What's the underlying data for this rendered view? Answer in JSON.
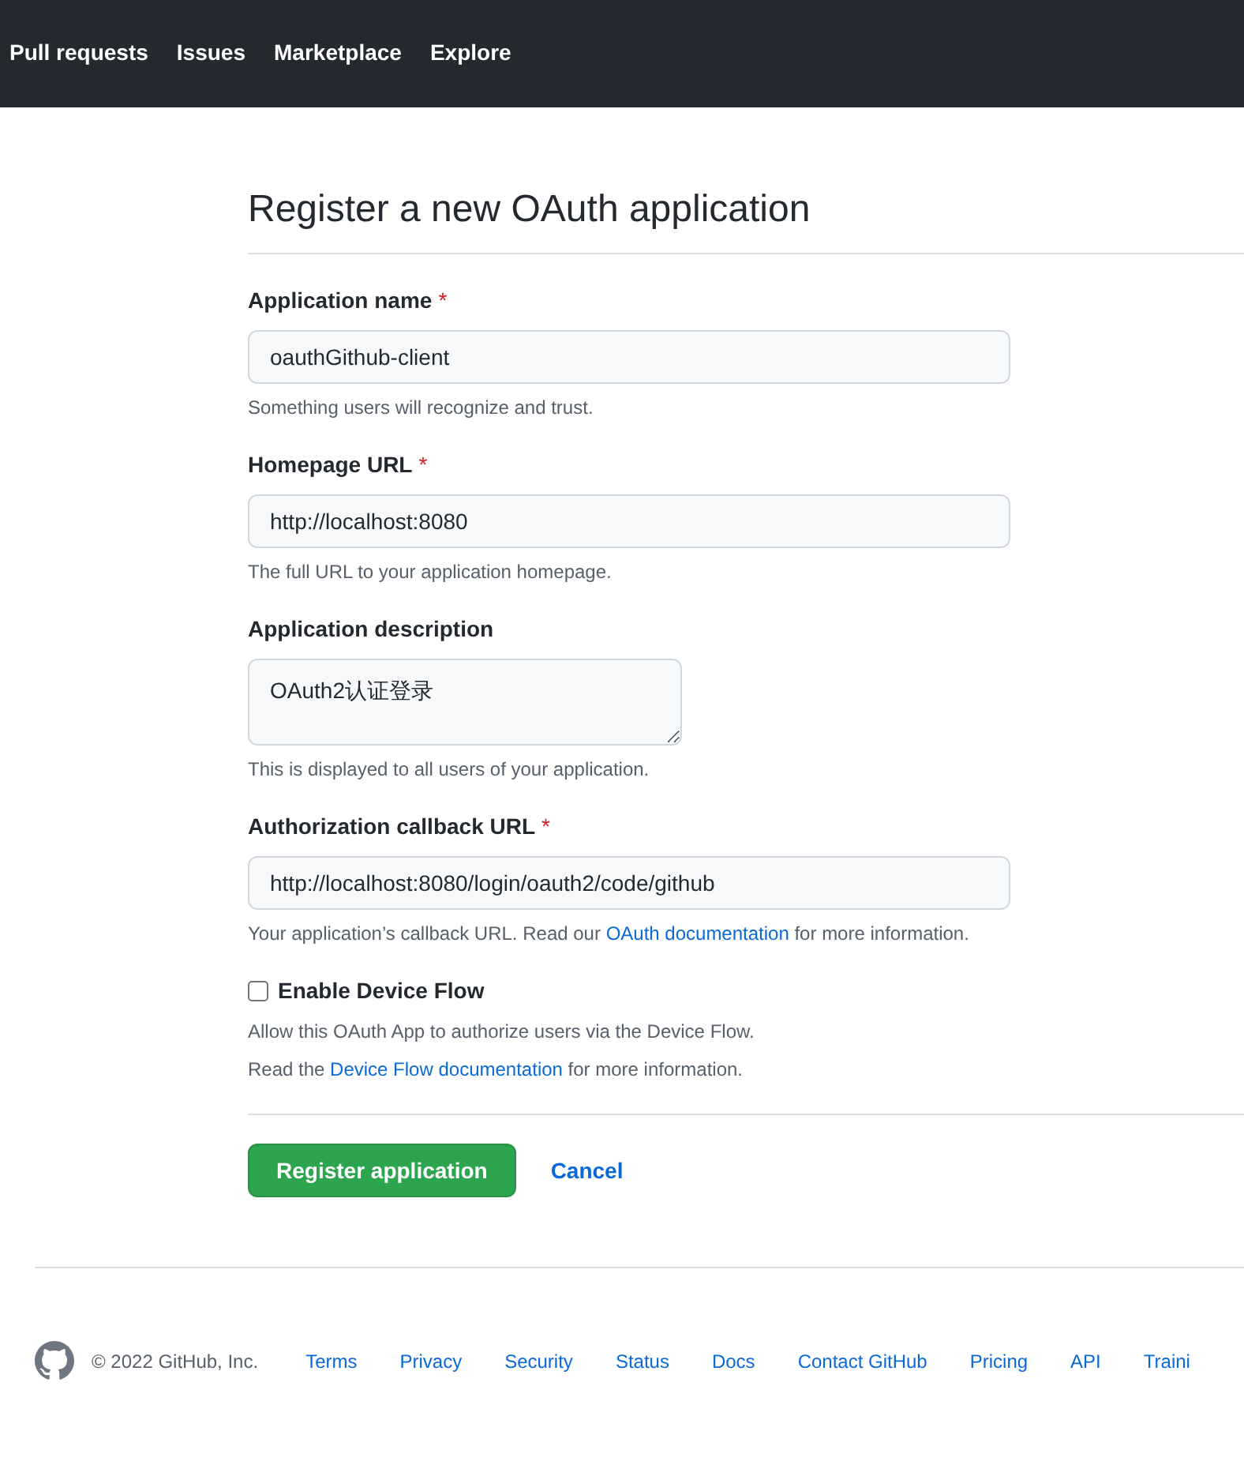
{
  "nav": {
    "items": [
      {
        "label": "Pull requests"
      },
      {
        "label": "Issues"
      },
      {
        "label": "Marketplace"
      },
      {
        "label": "Explore"
      }
    ]
  },
  "page": {
    "title": "Register a new OAuth application"
  },
  "fields": [
    {
      "kind": "input",
      "label": "Application name",
      "required_mark": "*",
      "value": "oauthGithub-client",
      "note": {
        "text": "Something users will recognize and trust."
      }
    },
    {
      "kind": "input",
      "label": "Homepage URL",
      "required_mark": "*",
      "value": "http://localhost:8080",
      "note": {
        "text": "The full URL to your application homepage."
      }
    },
    {
      "kind": "textarea",
      "label": "Application description",
      "value": "OAuth2认证登录",
      "note": {
        "text": "This is displayed to all users of your application."
      }
    },
    {
      "kind": "input",
      "label": "Authorization callback URL",
      "required_mark": "*",
      "value": "http://localhost:8080/login/oauth2/code/github",
      "note": {
        "text": "Your application’s callback URL. Read our ",
        "link": "OAuth documentation",
        "after": " for more information."
      }
    }
  ],
  "device_flow": {
    "label": "Enable Device Flow",
    "checked": false,
    "notes": [
      {
        "text": "Allow this OAuth App to authorize users via the Device Flow."
      },
      {
        "text": "Read the ",
        "link": "Device Flow documentation",
        "after": " for more information."
      }
    ]
  },
  "actions": {
    "submit": "Register application",
    "cancel": "Cancel"
  },
  "footer": {
    "copyright": "© 2022 GitHub, Inc.",
    "links": [
      "Terms",
      "Privacy",
      "Security",
      "Status",
      "Docs",
      "Contact GitHub",
      "Pricing",
      "API",
      "Traini"
    ]
  }
}
